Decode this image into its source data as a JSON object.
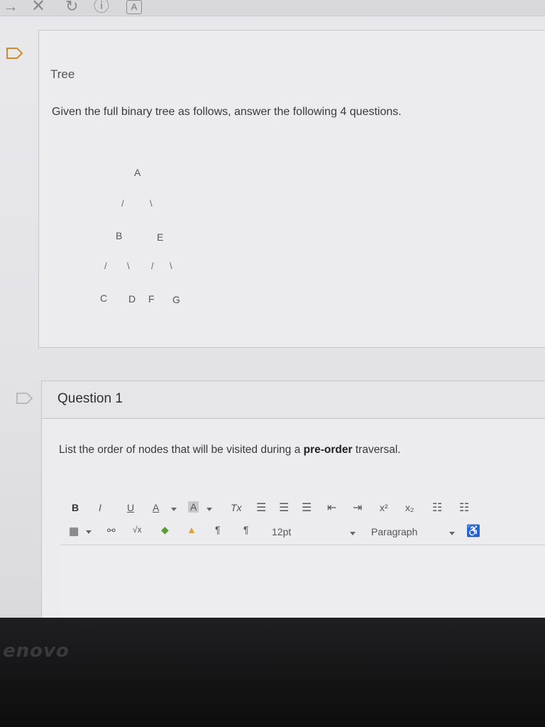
{
  "browser": {
    "icons": [
      "back-arrow-icon",
      "close-icon",
      "reload-icon",
      "info-icon",
      "reader-icon"
    ],
    "reader_glyph": "A"
  },
  "section": {
    "title": "Tree",
    "intro": "Given the full binary tree as follows, answer the following 4 questions.",
    "tree": {
      "nodes": [
        "A",
        "B",
        "E",
        "C",
        "D",
        "F",
        "G"
      ],
      "edge_row1": [
        "/",
        "\\"
      ],
      "edge_row2": [
        "/",
        "\\",
        "/",
        "\\"
      ]
    }
  },
  "question": {
    "title": "Question 1",
    "prompt_before": "List the order of nodes that will be visited during a ",
    "prompt_bold": "pre-order",
    "prompt_after": " traversal."
  },
  "toolbar": {
    "bold": "B",
    "italic": "I",
    "underline": "U",
    "font_color": "A",
    "bg_color": "A",
    "clear_format": "Tx",
    "superscript": "x²",
    "subscript": "x₂",
    "font_size": "12pt",
    "block_format": "Paragraph"
  },
  "laptop": {
    "brand": "enovo"
  },
  "colors": {
    "card_bg": "#ececef",
    "border": "#c6c6ca",
    "bezel": "#141415"
  }
}
